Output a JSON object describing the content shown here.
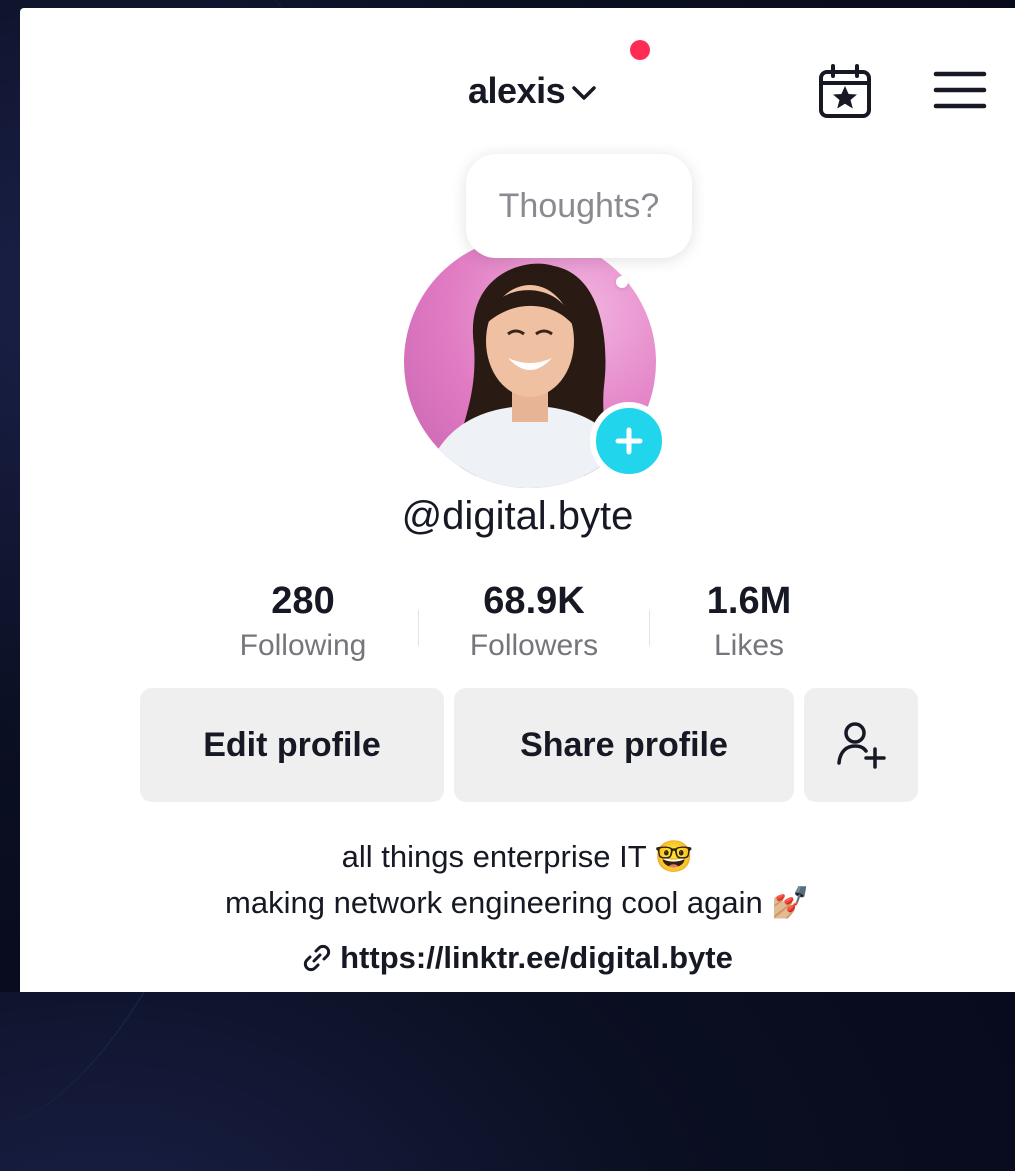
{
  "header": {
    "username": "alexis",
    "accent_dot_color": "#fe2c55",
    "icons": [
      "chevron-down-icon",
      "calendar-star-icon",
      "menu-icon"
    ]
  },
  "avatar": {
    "note_bubble": "Thoughts?",
    "badge_color": "#20d5ec"
  },
  "profile": {
    "handle": "@digital.byte",
    "stats": [
      {
        "value": "280",
        "label": "Following"
      },
      {
        "value": "68.9K",
        "label": "Followers"
      },
      {
        "value": "1.6M",
        "label": "Likes"
      }
    ]
  },
  "actions": {
    "edit_label": "Edit profile",
    "share_label": "Share profile"
  },
  "bio": {
    "line1": "all things enterprise IT 🤓",
    "line2": "making network engineering cool again 💅🏼",
    "link": "https://linktr.ee/digital.byte"
  }
}
